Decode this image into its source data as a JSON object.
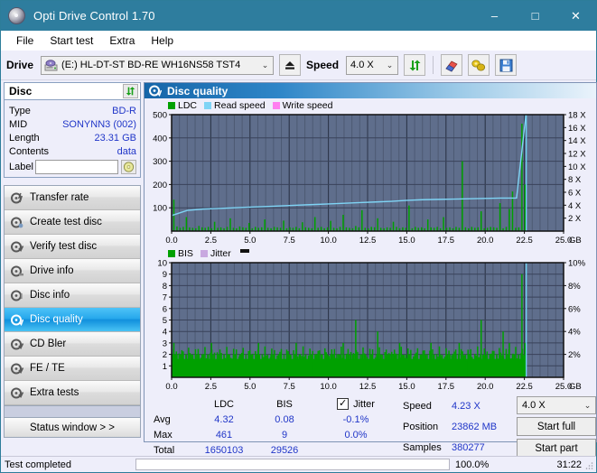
{
  "window": {
    "title": "Opti Drive Control 1.70",
    "icon": "disc-icon",
    "minimize": "–",
    "maximize": "□",
    "close": "✕"
  },
  "menu": {
    "items": [
      {
        "label": "File"
      },
      {
        "label": "Start test"
      },
      {
        "label": "Extra"
      },
      {
        "label": "Help"
      }
    ]
  },
  "toolbar": {
    "drive_label": "Drive",
    "drive_value": "(E:)  HL-DT-ST BD-RE  WH16NS58 TST4",
    "eject_icon": "eject-icon",
    "speed_label": "Speed",
    "speed_value": "4.0 X",
    "refresh_icon": "refresh-icon",
    "erase_icon": "eraser-icon",
    "bell_icon": "bell-icon",
    "save_icon": "save-icon"
  },
  "disc_panel": {
    "title": "Disc",
    "refresh_icon": "refresh-icon",
    "rows": [
      {
        "key": "Type",
        "value": "BD-R"
      },
      {
        "key": "MID",
        "value": "SONYNN3 (002)"
      },
      {
        "key": "Length",
        "value": "23.31 GB"
      },
      {
        "key": "Contents",
        "value": "data"
      }
    ],
    "label_key": "Label",
    "label_value": "",
    "label_placeholder": "",
    "disc_button_icon": "disc-icon"
  },
  "sidebar": {
    "items": [
      {
        "label": "Transfer rate",
        "icon": "disc-test-icon",
        "selected": false
      },
      {
        "label": "Create test disc",
        "icon": "disc-write-icon",
        "selected": false
      },
      {
        "label": "Verify test disc",
        "icon": "disc-verify-icon",
        "selected": false
      },
      {
        "label": "Drive info",
        "icon": "drive-info-icon",
        "selected": false
      },
      {
        "label": "Disc info",
        "icon": "disc-info-icon",
        "selected": false
      },
      {
        "label": "Disc quality",
        "icon": "disc-quality-icon",
        "selected": true
      },
      {
        "label": "CD Bler",
        "icon": "cd-bler-icon",
        "selected": false
      },
      {
        "label": "FE / TE",
        "icon": "fe-te-icon",
        "selected": false
      },
      {
        "label": "Extra tests",
        "icon": "extra-tests-icon",
        "selected": false
      }
    ],
    "status_window": "Status window > >"
  },
  "panel": {
    "title": "Disc quality",
    "icon": "disc-quality-icon"
  },
  "chart_data": [
    {
      "type": "line",
      "id": "ldc-chart",
      "title": "Disc quality",
      "xlabel": "GB",
      "ylabel": "",
      "xlim": [
        0,
        25
      ],
      "ylim": [
        0,
        500
      ],
      "y2lim": [
        0,
        18
      ],
      "grid": true,
      "legend_position": "top-left",
      "legend": [
        {
          "label": "LDC",
          "color": "#00a000"
        },
        {
          "label": "Read speed",
          "color": "#7fd4f5"
        },
        {
          "label": "Write speed",
          "color": "#ff7ff0"
        }
      ],
      "xticks": [
        "0.0",
        "2.5",
        "5.0",
        "7.5",
        "10.0",
        "12.5",
        "15.0",
        "17.5",
        "20.0",
        "22.5",
        "25.0"
      ],
      "xunit": "GB",
      "yticks": [
        "100",
        "200",
        "300",
        "400",
        "500"
      ],
      "y2ticks": [
        "2 X",
        "4 X",
        "6 X",
        "8 X",
        "10 X",
        "12 X",
        "14 X",
        "16 X",
        "18 X"
      ],
      "series": [
        {
          "name": "LDC",
          "color": "#00a000",
          "type": "bar",
          "x": [
            0.1,
            0.3,
            0.5,
            0.7,
            0.9,
            1.1,
            1.3,
            1.5,
            1.7,
            1.9,
            2.1,
            2.3,
            2.5,
            2.7,
            2.9,
            3.1,
            3.3,
            3.5,
            3.7,
            3.9,
            4.1,
            4.3,
            4.5,
            4.7,
            4.9,
            5.1,
            5.3,
            5.5,
            5.7,
            5.9,
            6.1,
            6.3,
            6.5,
            6.7,
            6.9,
            7.1,
            7.3,
            7.5,
            7.7,
            7.9,
            8.1,
            8.3,
            8.5,
            8.7,
            8.9,
            9.1,
            9.3,
            9.5,
            9.7,
            9.9,
            10.1,
            10.3,
            10.5,
            10.7,
            10.9,
            11.1,
            11.3,
            11.5,
            11.7,
            11.9,
            12.1,
            12.3,
            12.5,
            12.7,
            12.9,
            13.1,
            13.3,
            13.5,
            13.7,
            13.9,
            14.1,
            14.3,
            14.5,
            14.7,
            14.9,
            15.1,
            15.3,
            15.5,
            15.7,
            15.9,
            16.1,
            16.3,
            16.5,
            16.7,
            16.9,
            17.1,
            17.3,
            17.5,
            17.7,
            17.9,
            18.1,
            18.3,
            18.5,
            18.7,
            18.9,
            19.1,
            19.3,
            19.5,
            19.7,
            19.9,
            20.1,
            20.3,
            20.5,
            20.7,
            20.9,
            21.1,
            21.3,
            21.5,
            21.7,
            21.9,
            22.1,
            22.3,
            22.5
          ],
          "values": [
            135,
            20,
            14,
            18,
            60,
            16,
            14,
            12,
            22,
            16,
            14,
            18,
            12,
            40,
            14,
            16,
            12,
            18,
            55,
            14,
            12,
            20,
            16,
            14,
            35,
            12,
            18,
            14,
            16,
            50,
            14,
            12,
            18,
            16,
            14,
            45,
            12,
            16,
            14,
            18,
            12,
            38,
            16,
            14,
            12,
            60,
            14,
            18,
            12,
            16,
            44,
            14,
            12,
            18,
            70,
            16,
            14,
            12,
            22,
            16,
            90,
            14,
            12,
            18,
            16,
            55,
            14,
            12,
            16,
            14,
            40,
            18,
            12,
            16,
            14,
            110,
            12,
            18,
            14,
            16,
            12,
            50,
            16,
            14,
            18,
            12,
            60,
            14,
            16,
            12,
            18,
            14,
            300,
            16,
            12,
            18,
            14,
            16,
            85,
            12,
            14,
            18,
            16,
            14,
            120,
            12,
            18,
            95,
            170,
            14,
            16,
            461,
            200
          ]
        },
        {
          "name": "Read speed",
          "color": "#7fd4f5",
          "type": "line",
          "x": [
            0.0,
            1.0,
            2.0,
            3.0,
            4.0,
            5.0,
            6.0,
            7.0,
            8.0,
            9.0,
            10.0,
            11.0,
            12.0,
            13.0,
            14.0,
            15.0,
            16.0,
            17.0,
            18.0,
            19.0,
            20.0,
            21.0,
            22.0,
            22.6
          ],
          "values": [
            2.4,
            3.2,
            3.4,
            3.5,
            3.6,
            3.7,
            3.8,
            3.9,
            4.0,
            4.1,
            4.2,
            4.3,
            4.4,
            4.5,
            4.6,
            4.75,
            4.85,
            4.9,
            4.95,
            5.0,
            5.05,
            5.1,
            5.1,
            18.0
          ]
        }
      ]
    },
    {
      "type": "line",
      "id": "bis-chart",
      "title": "",
      "xlabel": "GB",
      "xlim": [
        0,
        25
      ],
      "ylim": [
        0,
        10
      ],
      "y2lim": [
        0,
        10
      ],
      "grid": true,
      "legend_position": "top-left",
      "legend": [
        {
          "label": "BIS",
          "color": "#00a000"
        },
        {
          "label": "Jitter",
          "color": "#c8a8e0"
        }
      ],
      "xticks": [
        "0.0",
        "2.5",
        "5.0",
        "7.5",
        "10.0",
        "12.5",
        "15.0",
        "17.5",
        "20.0",
        "22.5",
        "25.0"
      ],
      "xunit": "GB",
      "yticks": [
        "1",
        "2",
        "3",
        "4",
        "5",
        "6",
        "7",
        "8",
        "9",
        "10"
      ],
      "y2ticks": [
        "2%",
        "4%",
        "6%",
        "8%",
        "10%"
      ],
      "series": [
        {
          "name": "BIS",
          "color": "#00a000",
          "type": "bar",
          "x": [
            0.1,
            0.3,
            0.5,
            0.7,
            0.9,
            1.1,
            1.3,
            1.5,
            1.7,
            1.9,
            2.1,
            2.3,
            2.5,
            2.7,
            2.9,
            3.1,
            3.3,
            3.5,
            3.7,
            3.9,
            4.1,
            4.3,
            4.5,
            4.7,
            4.9,
            5.1,
            5.3,
            5.5,
            5.7,
            5.9,
            6.1,
            6.3,
            6.5,
            6.7,
            6.9,
            7.1,
            7.3,
            7.5,
            7.7,
            7.9,
            8.1,
            8.3,
            8.5,
            8.7,
            8.9,
            9.1,
            9.3,
            9.5,
            9.7,
            9.9,
            10.1,
            10.3,
            10.5,
            10.7,
            10.9,
            11.1,
            11.3,
            11.5,
            11.7,
            11.9,
            12.1,
            12.3,
            12.5,
            12.7,
            12.9,
            13.1,
            13.3,
            13.5,
            13.7,
            13.9,
            14.1,
            14.3,
            14.5,
            14.7,
            14.9,
            15.1,
            15.3,
            15.5,
            15.7,
            15.9,
            16.1,
            16.3,
            16.5,
            16.7,
            16.9,
            17.1,
            17.3,
            17.5,
            17.7,
            17.9,
            18.1,
            18.3,
            18.5,
            18.7,
            18.9,
            19.1,
            19.3,
            19.5,
            19.7,
            19.9,
            20.1,
            20.3,
            20.5,
            20.7,
            20.9,
            21.1,
            21.3,
            21.5,
            21.7,
            21.9,
            22.1,
            22.3,
            22.5
          ],
          "values": [
            3,
            2,
            1,
            2,
            2,
            1,
            2,
            1,
            2,
            2,
            1,
            2,
            3,
            1,
            2,
            1,
            2,
            2,
            1,
            2,
            1,
            2,
            1,
            2,
            2,
            1,
            2,
            3,
            1,
            2,
            1,
            2,
            2,
            1,
            2,
            1,
            2,
            2,
            1,
            3,
            2,
            1,
            2,
            1,
            2,
            2,
            1,
            2,
            1,
            2,
            2,
            1,
            2,
            1,
            3,
            2,
            1,
            2,
            5,
            1,
            2,
            2,
            1,
            2,
            1,
            4,
            2,
            1,
            2,
            2,
            1,
            2,
            3,
            1,
            2,
            2,
            1,
            2,
            1,
            2,
            2,
            1,
            3,
            2,
            1,
            2,
            1,
            2,
            2,
            1,
            2,
            3,
            1,
            2,
            2,
            1,
            2,
            1,
            5,
            2,
            1,
            2,
            1,
            2,
            2,
            4,
            1,
            3,
            2,
            1,
            2,
            9,
            3
          ]
        },
        {
          "name": "Jitter",
          "color": "#c8a8e0",
          "type": "line",
          "x": [],
          "values": []
        }
      ]
    }
  ],
  "stats": {
    "headers": [
      "",
      "LDC",
      "BIS",
      "Jitter"
    ],
    "jitter_checked": true,
    "jitter_check_glyph": "✓",
    "rows": [
      {
        "key": "Avg",
        "ldc": "4.32",
        "bis": "0.08",
        "jitter": "-0.1%"
      },
      {
        "key": "Max",
        "ldc": "461",
        "bis": "9",
        "jitter": "0.0%"
      },
      {
        "key": "Total",
        "ldc": "1650103",
        "bis": "29526",
        "jitter": ""
      }
    ]
  },
  "readout": {
    "speed_key": "Speed",
    "speed_value": "4.23 X",
    "position_key": "Position",
    "position_value": "23862 MB",
    "samples_key": "Samples",
    "samples_value": "380277"
  },
  "actions": {
    "speed_select": "4.0 X",
    "start_full": "Start full",
    "start_part": "Start part"
  },
  "statusbar": {
    "text": "Test completed",
    "progress_percent": "100.0%",
    "progress_value": 100,
    "elapsed": "31:22"
  },
  "colors": {
    "titlebar": "#2e7d9e",
    "accent_blue": "#2036c8",
    "green": "#00a000",
    "plot_bg": "#5f6e8c",
    "read_speed": "#7fd4f5",
    "write_speed": "#ff7ff0",
    "jitter": "#c8a8e0",
    "progress": "#16a810"
  }
}
